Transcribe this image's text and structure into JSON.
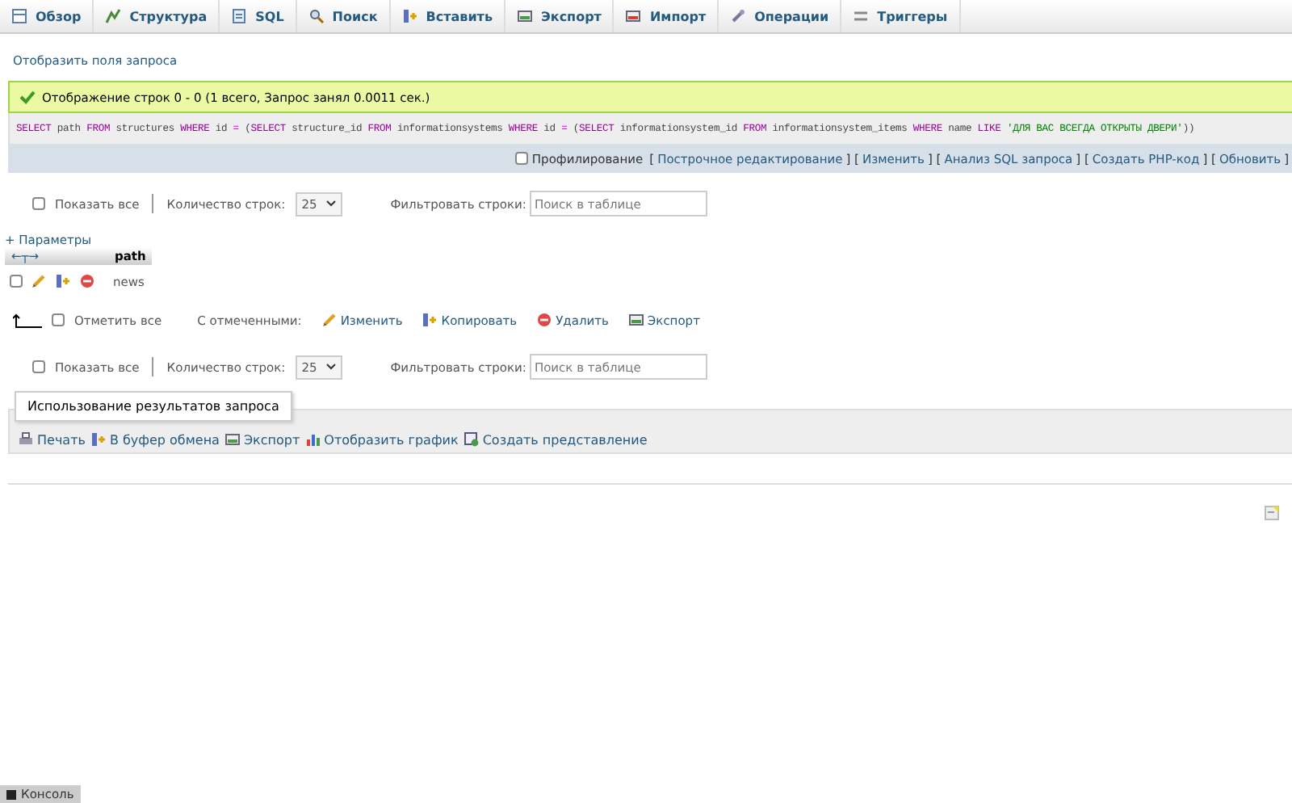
{
  "tabs": [
    {
      "label": "Обзор",
      "selected": false
    },
    {
      "label": "Структура",
      "selected": false
    },
    {
      "label": "SQL",
      "selected": false
    },
    {
      "label": "Поиск",
      "selected": false
    },
    {
      "label": "Вставить",
      "selected": false
    },
    {
      "label": "Экспорт",
      "selected": false
    },
    {
      "label": "Импорт",
      "selected": false
    },
    {
      "label": "Операции",
      "selected": false
    },
    {
      "label": "Триггеры",
      "selected": false
    }
  ],
  "show_query_link": "Отобразить поля запроса",
  "success_message": "Отображение строк 0 - 0 (1 всего, Запрос занял 0.0011 сек.)",
  "query_tokens": [
    {
      "kind": "keyword",
      "text": "SELECT"
    },
    {
      "kind": "plain",
      "text": " path "
    },
    {
      "kind": "keyword",
      "text": "FROM"
    },
    {
      "kind": "plain",
      "text": " structures "
    },
    {
      "kind": "keyword",
      "text": "WHERE"
    },
    {
      "kind": "plain",
      "text": " id "
    },
    {
      "kind": "operator",
      "text": "="
    },
    {
      "kind": "plain",
      "text": " ("
    },
    {
      "kind": "keyword",
      "text": "SELECT"
    },
    {
      "kind": "plain",
      "text": " structure_id "
    },
    {
      "kind": "keyword",
      "text": "FROM"
    },
    {
      "kind": "plain",
      "text": " informationsystems "
    },
    {
      "kind": "keyword",
      "text": "WHERE"
    },
    {
      "kind": "plain",
      "text": " id "
    },
    {
      "kind": "operator",
      "text": "="
    },
    {
      "kind": "plain",
      "text": " ("
    },
    {
      "kind": "keyword",
      "text": "SELECT"
    },
    {
      "kind": "plain",
      "text": " informationsystem_id "
    },
    {
      "kind": "keyword",
      "text": "FROM"
    },
    {
      "kind": "plain",
      "text": " informationsystem_items "
    },
    {
      "kind": "keyword",
      "text": "WHERE"
    },
    {
      "kind": "plain",
      "text": " name "
    },
    {
      "kind": "keyword",
      "text": "LIKE "
    },
    {
      "kind": "string",
      "text": "'ДЛЯ ВАС ВСЕГДА ОТКРЫТЫ ДВЕРИ'"
    },
    {
      "kind": "plain",
      "text": "))"
    }
  ],
  "profiling": {
    "label": "Профилирование",
    "checked": false
  },
  "query_links": [
    "Построчное редактирование",
    "Изменить",
    "Анализ SQL запроса",
    "Создать PHP-код",
    "Обновить"
  ],
  "query_link_brackets": [
    "[",
    "] [",
    "] [",
    "] [",
    "] [",
    "]"
  ],
  "column_arrows": "←┬→",
  "navigation": [
    {
      "show_all": "Показать все",
      "show_all_checked": false,
      "rows_label": "Количество строк:",
      "rows_value": "25",
      "filter_label": "Фильтровать строки:",
      "filter_placeholder": "Поиск в таблице"
    },
    {
      "show_all": "Показать все",
      "show_all_checked": false,
      "rows_label": "Количество строк:",
      "rows_value": "25",
      "filter_label": "Фильтровать строки:",
      "filter_placeholder": "Поиск в таблице"
    }
  ],
  "options_link": "+ Параметры",
  "table": {
    "columns": [
      "path"
    ],
    "rows": [
      {
        "checked": false,
        "cells": [
          "news"
        ]
      }
    ]
  },
  "bulk": {
    "check_all": "Отметить все",
    "checked": false,
    "with_selected": "С отмеченными:",
    "actions": [
      {
        "kind": "edit",
        "label": "Изменить"
      },
      {
        "kind": "copy",
        "label": "Копировать"
      },
      {
        "kind": "delete",
        "label": "Удалить"
      },
      {
        "kind": "export",
        "label": "Экспорт"
      }
    ]
  },
  "results": {
    "legend": "Использование результатов запроса",
    "actions": [
      {
        "kind": "print",
        "label": "Печать"
      },
      {
        "kind": "copy",
        "label": "В буфер обмена"
      },
      {
        "kind": "export",
        "label": "Экспорт"
      },
      {
        "kind": "chart",
        "label": "Отобразить график"
      },
      {
        "kind": "view",
        "label": "Создать представление"
      }
    ]
  },
  "console": "Консоль"
}
